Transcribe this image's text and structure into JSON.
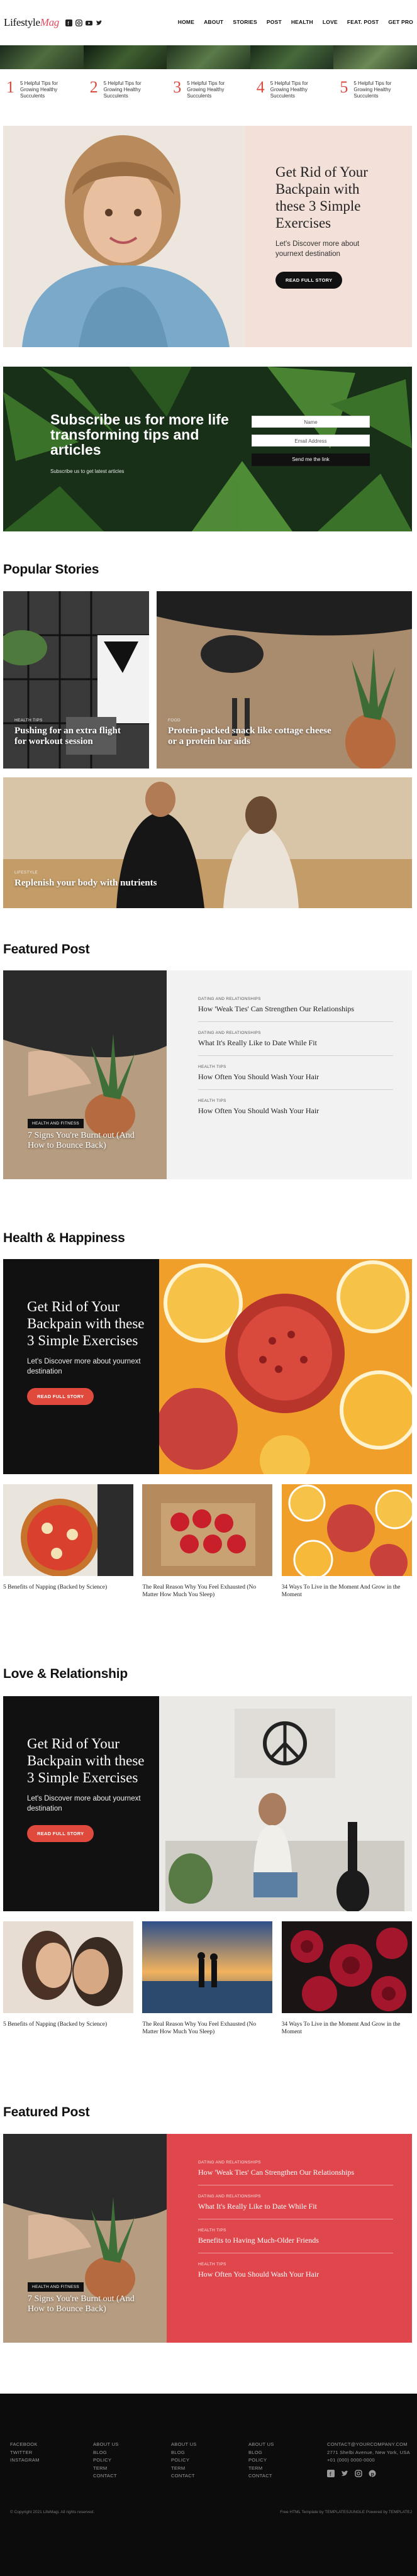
{
  "header": {
    "logo_main": "Lifestyle",
    "logo_accent": "Mag",
    "nav": [
      "HOME",
      "ABOUT",
      "STORIES",
      "POST",
      "HEALTH",
      "LOVE",
      "FEAT. POST",
      "GET PRO"
    ]
  },
  "tips": [
    {
      "num": "1",
      "text": "5 Helpful Tips for Growing Healthy Succulents"
    },
    {
      "num": "2",
      "text": "5 Helpful Tips for Growing Healthy Succulents"
    },
    {
      "num": "3",
      "text": "5 Helpful Tips for Growing Healthy Succulents"
    },
    {
      "num": "4",
      "text": "5 Helpful Tips for Growing Healthy Succulents"
    },
    {
      "num": "5",
      "text": "5 Helpful Tips for Growing Healthy Succulents"
    }
  ],
  "hero": {
    "title": "Get Rid of Your Backpain with these 3 Simple Exercises",
    "subtitle": "Let's Discover more about yournext destination",
    "button": "READ FULL STORY"
  },
  "subscribe": {
    "title": "Subscribe us for more life transforming tips and articles",
    "small": "Subscribe us to get latest articles",
    "name_placeholder": "Name",
    "email_placeholder": "Email Address",
    "button": "Send me the link"
  },
  "popular": {
    "title": "Popular Stories",
    "cards": [
      {
        "tag": "HEALTH TIPS",
        "caption": "Pushing for an extra flight for workout session"
      },
      {
        "tag": "FOOD",
        "caption": "Protein-packed snack like cottage cheese or a protein bar aids"
      },
      {
        "tag": "LIFESTYLE",
        "caption": "Replenish your body with nutrients"
      }
    ]
  },
  "featured1": {
    "title": "Featured Post",
    "badge": "HEALTH AND FITNESS",
    "caption": "7 Signs You're Burnt out (And How to Bounce Back)",
    "items": [
      {
        "cat": "DATING AND RELATIONSHIPS",
        "title": "How 'Weak Ties' Can Strengthen Our Relationships"
      },
      {
        "cat": "DATING AND RELATIONSHIPS",
        "title": "What It's Really Like to Date While Fit"
      },
      {
        "cat": "HEALTH TIPS",
        "title": "How Often You Should Wash Your Hair"
      },
      {
        "cat": "HEALTH TIPS",
        "title": "How Often You Should Wash Your Hair"
      }
    ]
  },
  "health": {
    "title": "Health & Happiness",
    "panel_title": "Get Rid of Your Backpain with these 3 Simple Exercises",
    "panel_sub": "Let's Discover more about yournext destination",
    "button": "READ FULL STORY",
    "items": [
      "5 Benefits of Napping (Backed by Science)",
      "The Real Reason Why You Feel Exhausted (No Matter How Much You Sleep)",
      "34 Ways To Live in the Moment And Grow in the Moment"
    ]
  },
  "love": {
    "title": "Love & Relationship",
    "panel_title": "Get Rid of Your Backpain with these 3 Simple Exercises",
    "panel_sub": "Let's Discover more about yournext destination",
    "button": "READ FULL STORY",
    "items": [
      "5 Benefits of Napping (Backed by Science)",
      "The Real Reason Why You Feel Exhausted (No Matter How Much You Sleep)",
      "34 Ways To Live in the Moment And Grow in the Moment"
    ]
  },
  "featured2": {
    "title": "Featured Post",
    "badge": "HEALTH AND FITNESS",
    "caption": "7 Signs You're Burnt out (And How to Bounce Back)",
    "items": [
      {
        "cat": "DATING AND RELATIONSHIPS",
        "title": "How 'Weak Ties' Can Strengthen Our Relationships"
      },
      {
        "cat": "DATING AND RELATIONSHIPS",
        "title": "What It's Really Like to Date While Fit"
      },
      {
        "cat": "HEALTH TIPS",
        "title": "Benefits to Having Much-Older Friends"
      },
      {
        "cat": "HEALTH TIPS",
        "title": "How Often You Should Wash Your Hair"
      }
    ],
    "accent": "#e0474c"
  },
  "footer": {
    "col1": [
      "FACEBOOK",
      "TWITTER",
      "INSTAGRAM"
    ],
    "col2": [
      "ABOUT US",
      "BLOG",
      "POLICY",
      "TERM",
      "CONTACT"
    ],
    "col3": [
      "ABOUT US",
      "BLOG",
      "POLICY",
      "TERM",
      "CONTACT"
    ],
    "col4": [
      "ABOUT US",
      "BLOG",
      "POLICY",
      "TERM",
      "CONTACT"
    ],
    "contact": [
      "CONTACT@YOURCOMPANY.COM",
      "2771 Shelbi Avenue, New York, USA",
      "+01 (000) 0000-0000"
    ],
    "copyright": "© Copyright 2021 LifeMagi. All rights reserved.",
    "credit": "Free HTML Template by TEMPLATESJUNGLE Powered by TEMPLATEJ"
  }
}
